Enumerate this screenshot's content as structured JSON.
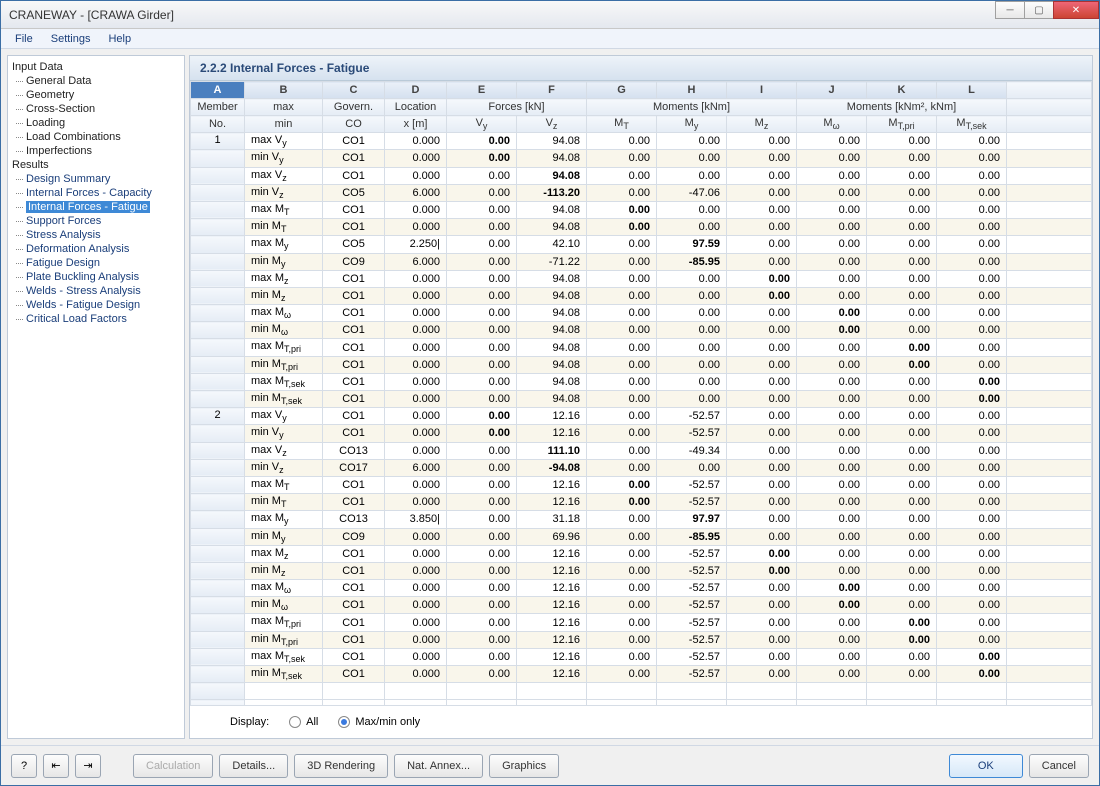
{
  "titlebar": "CRANEWAY - [CRAWA Girder]",
  "menu": {
    "file": "File",
    "settings": "Settings",
    "help": "Help"
  },
  "nav": {
    "input": "Input Data",
    "input_items": [
      "General Data",
      "Geometry",
      "Cross-Section",
      "Loading",
      "Load Combinations",
      "Imperfections"
    ],
    "results": "Results",
    "result_items": [
      "Design Summary",
      "Internal Forces - Capacity",
      "Internal Forces - Fatigue",
      "Support Forces",
      "Stress Analysis",
      "Deformation Analysis",
      "Fatigue Design",
      "Plate Buckling Analysis",
      "Welds - Stress Analysis",
      "Welds - Fatigue Design",
      "Critical Load Factors"
    ],
    "selected": "Internal Forces - Fatigue"
  },
  "main": {
    "header": "2.2.2 Internal Forces - Fatigue"
  },
  "cols": {
    "letters": [
      "A",
      "B",
      "C",
      "D",
      "E",
      "F",
      "G",
      "H",
      "I",
      "J",
      "K",
      "L"
    ]
  },
  "head": {
    "r1": {
      "A": "Member",
      "B": "max",
      "C": "Govern.",
      "D": "Location",
      "EF": "Forces [kN]",
      "GHI": "Moments [kNm]",
      "JKL": "Moments [kNm², kNm]"
    },
    "r2": {
      "A": "No.",
      "B": "min",
      "C": "CO",
      "D": "x [m]",
      "E": "V|y",
      "F": "V|z",
      "G": "M|T",
      "H": "M|y",
      "I": "M|z",
      "J": "M|ω",
      "K": "M|T,pri",
      "L": "M|T,sek"
    }
  },
  "rows": [
    {
      "mem": "1",
      "lbl": "max V|y",
      "co": "CO1",
      "x": "0.000",
      "vy": "0.00",
      "vz": "94.08",
      "mt": "0.00",
      "my": "0.00",
      "mz": "0.00",
      "mw": "0.00",
      "mtp": "0.00",
      "mts": "0.00",
      "bold": "vy"
    },
    {
      "mem": "",
      "lbl": "min V|y",
      "co": "CO1",
      "x": "0.000",
      "vy": "0.00",
      "vz": "94.08",
      "mt": "0.00",
      "my": "0.00",
      "mz": "0.00",
      "mw": "0.00",
      "mtp": "0.00",
      "mts": "0.00",
      "bold": "vy"
    },
    {
      "mem": "",
      "lbl": "max V|z",
      "co": "CO1",
      "x": "0.000",
      "vy": "0.00",
      "vz": "94.08",
      "mt": "0.00",
      "my": "0.00",
      "mz": "0.00",
      "mw": "0.00",
      "mtp": "0.00",
      "mts": "0.00",
      "bold": "vz"
    },
    {
      "mem": "",
      "lbl": "min V|z",
      "co": "CO5",
      "x": "6.000",
      "vy": "0.00",
      "vz": "-113.20",
      "mt": "0.00",
      "my": "-47.06",
      "mz": "0.00",
      "mw": "0.00",
      "mtp": "0.00",
      "mts": "0.00",
      "bold": "vz"
    },
    {
      "mem": "",
      "lbl": "max M|T",
      "co": "CO1",
      "x": "0.000",
      "vy": "0.00",
      "vz": "94.08",
      "mt": "0.00",
      "my": "0.00",
      "mz": "0.00",
      "mw": "0.00",
      "mtp": "0.00",
      "mts": "0.00",
      "bold": "mt"
    },
    {
      "mem": "",
      "lbl": "min M|T",
      "co": "CO1",
      "x": "0.000",
      "vy": "0.00",
      "vz": "94.08",
      "mt": "0.00",
      "my": "0.00",
      "mz": "0.00",
      "mw": "0.00",
      "mtp": "0.00",
      "mts": "0.00",
      "bold": "mt"
    },
    {
      "mem": "",
      "lbl": "max M|y",
      "co": "CO5",
      "x": "2.250|",
      "vy": "0.00",
      "vz": "42.10",
      "mt": "0.00",
      "my": "97.59",
      "mz": "0.00",
      "mw": "0.00",
      "mtp": "0.00",
      "mts": "0.00",
      "bold": "my"
    },
    {
      "mem": "",
      "lbl": "min M|y",
      "co": "CO9",
      "x": "6.000",
      "vy": "0.00",
      "vz": "-71.22",
      "mt": "0.00",
      "my": "-85.95",
      "mz": "0.00",
      "mw": "0.00",
      "mtp": "0.00",
      "mts": "0.00",
      "bold": "my"
    },
    {
      "mem": "",
      "lbl": "max M|z",
      "co": "CO1",
      "x": "0.000",
      "vy": "0.00",
      "vz": "94.08",
      "mt": "0.00",
      "my": "0.00",
      "mz": "0.00",
      "mw": "0.00",
      "mtp": "0.00",
      "mts": "0.00",
      "bold": "mz"
    },
    {
      "mem": "",
      "lbl": "min M|z",
      "co": "CO1",
      "x": "0.000",
      "vy": "0.00",
      "vz": "94.08",
      "mt": "0.00",
      "my": "0.00",
      "mz": "0.00",
      "mw": "0.00",
      "mtp": "0.00",
      "mts": "0.00",
      "bold": "mz"
    },
    {
      "mem": "",
      "lbl": "max M|ω",
      "co": "CO1",
      "x": "0.000",
      "vy": "0.00",
      "vz": "94.08",
      "mt": "0.00",
      "my": "0.00",
      "mz": "0.00",
      "mw": "0.00",
      "mtp": "0.00",
      "mts": "0.00",
      "bold": "mw"
    },
    {
      "mem": "",
      "lbl": "min M|ω",
      "co": "CO1",
      "x": "0.000",
      "vy": "0.00",
      "vz": "94.08",
      "mt": "0.00",
      "my": "0.00",
      "mz": "0.00",
      "mw": "0.00",
      "mtp": "0.00",
      "mts": "0.00",
      "bold": "mw"
    },
    {
      "mem": "",
      "lbl": "max M|T,pri",
      "co": "CO1",
      "x": "0.000",
      "vy": "0.00",
      "vz": "94.08",
      "mt": "0.00",
      "my": "0.00",
      "mz": "0.00",
      "mw": "0.00",
      "mtp": "0.00",
      "mts": "0.00",
      "bold": "mtp"
    },
    {
      "mem": "",
      "lbl": "min M|T,pri",
      "co": "CO1",
      "x": "0.000",
      "vy": "0.00",
      "vz": "94.08",
      "mt": "0.00",
      "my": "0.00",
      "mz": "0.00",
      "mw": "0.00",
      "mtp": "0.00",
      "mts": "0.00",
      "bold": "mtp"
    },
    {
      "mem": "",
      "lbl": "max M|T,sek",
      "co": "CO1",
      "x": "0.000",
      "vy": "0.00",
      "vz": "94.08",
      "mt": "0.00",
      "my": "0.00",
      "mz": "0.00",
      "mw": "0.00",
      "mtp": "0.00",
      "mts": "0.00",
      "bold": "mts"
    },
    {
      "mem": "",
      "lbl": "min M|T,sek",
      "co": "CO1",
      "x": "0.000",
      "vy": "0.00",
      "vz": "94.08",
      "mt": "0.00",
      "my": "0.00",
      "mz": "0.00",
      "mw": "0.00",
      "mtp": "0.00",
      "mts": "0.00",
      "bold": "mts"
    },
    {
      "mem": "2",
      "lbl": "max V|y",
      "co": "CO1",
      "x": "0.000",
      "vy": "0.00",
      "vz": "12.16",
      "mt": "0.00",
      "my": "-52.57",
      "mz": "0.00",
      "mw": "0.00",
      "mtp": "0.00",
      "mts": "0.00",
      "bold": "vy"
    },
    {
      "mem": "",
      "lbl": "min V|y",
      "co": "CO1",
      "x": "0.000",
      "vy": "0.00",
      "vz": "12.16",
      "mt": "0.00",
      "my": "-52.57",
      "mz": "0.00",
      "mw": "0.00",
      "mtp": "0.00",
      "mts": "0.00",
      "bold": "vy"
    },
    {
      "mem": "",
      "lbl": "max V|z",
      "co": "CO13",
      "x": "0.000",
      "vy": "0.00",
      "vz": "111.10",
      "mt": "0.00",
      "my": "-49.34",
      "mz": "0.00",
      "mw": "0.00",
      "mtp": "0.00",
      "mts": "0.00",
      "bold": "vz"
    },
    {
      "mem": "",
      "lbl": "min V|z",
      "co": "CO17",
      "x": "6.000",
      "vy": "0.00",
      "vz": "-94.08",
      "mt": "0.00",
      "my": "0.00",
      "mz": "0.00",
      "mw": "0.00",
      "mtp": "0.00",
      "mts": "0.00",
      "bold": "vz"
    },
    {
      "mem": "",
      "lbl": "max M|T",
      "co": "CO1",
      "x": "0.000",
      "vy": "0.00",
      "vz": "12.16",
      "mt": "0.00",
      "my": "-52.57",
      "mz": "0.00",
      "mw": "0.00",
      "mtp": "0.00",
      "mts": "0.00",
      "bold": "mt"
    },
    {
      "mem": "",
      "lbl": "min M|T",
      "co": "CO1",
      "x": "0.000",
      "vy": "0.00",
      "vz": "12.16",
      "mt": "0.00",
      "my": "-52.57",
      "mz": "0.00",
      "mw": "0.00",
      "mtp": "0.00",
      "mts": "0.00",
      "bold": "mt"
    },
    {
      "mem": "",
      "lbl": "max M|y",
      "co": "CO13",
      "x": "3.850|",
      "vy": "0.00",
      "vz": "31.18",
      "mt": "0.00",
      "my": "97.97",
      "mz": "0.00",
      "mw": "0.00",
      "mtp": "0.00",
      "mts": "0.00",
      "bold": "my"
    },
    {
      "mem": "",
      "lbl": "min M|y",
      "co": "CO9",
      "x": "0.000",
      "vy": "0.00",
      "vz": "69.96",
      "mt": "0.00",
      "my": "-85.95",
      "mz": "0.00",
      "mw": "0.00",
      "mtp": "0.00",
      "mts": "0.00",
      "bold": "my"
    },
    {
      "mem": "",
      "lbl": "max M|z",
      "co": "CO1",
      "x": "0.000",
      "vy": "0.00",
      "vz": "12.16",
      "mt": "0.00",
      "my": "-52.57",
      "mz": "0.00",
      "mw": "0.00",
      "mtp": "0.00",
      "mts": "0.00",
      "bold": "mz"
    },
    {
      "mem": "",
      "lbl": "min M|z",
      "co": "CO1",
      "x": "0.000",
      "vy": "0.00",
      "vz": "12.16",
      "mt": "0.00",
      "my": "-52.57",
      "mz": "0.00",
      "mw": "0.00",
      "mtp": "0.00",
      "mts": "0.00",
      "bold": "mz"
    },
    {
      "mem": "",
      "lbl": "max M|ω",
      "co": "CO1",
      "x": "0.000",
      "vy": "0.00",
      "vz": "12.16",
      "mt": "0.00",
      "my": "-52.57",
      "mz": "0.00",
      "mw": "0.00",
      "mtp": "0.00",
      "mts": "0.00",
      "bold": "mw"
    },
    {
      "mem": "",
      "lbl": "min M|ω",
      "co": "CO1",
      "x": "0.000",
      "vy": "0.00",
      "vz": "12.16",
      "mt": "0.00",
      "my": "-52.57",
      "mz": "0.00",
      "mw": "0.00",
      "mtp": "0.00",
      "mts": "0.00",
      "bold": "mw"
    },
    {
      "mem": "",
      "lbl": "max M|T,pri",
      "co": "CO1",
      "x": "0.000",
      "vy": "0.00",
      "vz": "12.16",
      "mt": "0.00",
      "my": "-52.57",
      "mz": "0.00",
      "mw": "0.00",
      "mtp": "0.00",
      "mts": "0.00",
      "bold": "mtp"
    },
    {
      "mem": "",
      "lbl": "min M|T,pri",
      "co": "CO1",
      "x": "0.000",
      "vy": "0.00",
      "vz": "12.16",
      "mt": "0.00",
      "my": "-52.57",
      "mz": "0.00",
      "mw": "0.00",
      "mtp": "0.00",
      "mts": "0.00",
      "bold": "mtp"
    },
    {
      "mem": "",
      "lbl": "max M|T,sek",
      "co": "CO1",
      "x": "0.000",
      "vy": "0.00",
      "vz": "12.16",
      "mt": "0.00",
      "my": "-52.57",
      "mz": "0.00",
      "mw": "0.00",
      "mtp": "0.00",
      "mts": "0.00",
      "bold": "mts"
    },
    {
      "mem": "",
      "lbl": "min M|T,sek",
      "co": "CO1",
      "x": "0.000",
      "vy": "0.00",
      "vz": "12.16",
      "mt": "0.00",
      "my": "-52.57",
      "mz": "0.00",
      "mw": "0.00",
      "mtp": "0.00",
      "mts": "0.00",
      "bold": "mts"
    }
  ],
  "display": {
    "label": "Display:",
    "all": "All",
    "maxmin": "Max/min only"
  },
  "buttons": {
    "calc": "Calculation",
    "details": "Details...",
    "render": "3D Rendering",
    "annex": "Nat. Annex...",
    "graphics": "Graphics",
    "ok": "OK",
    "cancel": "Cancel"
  }
}
